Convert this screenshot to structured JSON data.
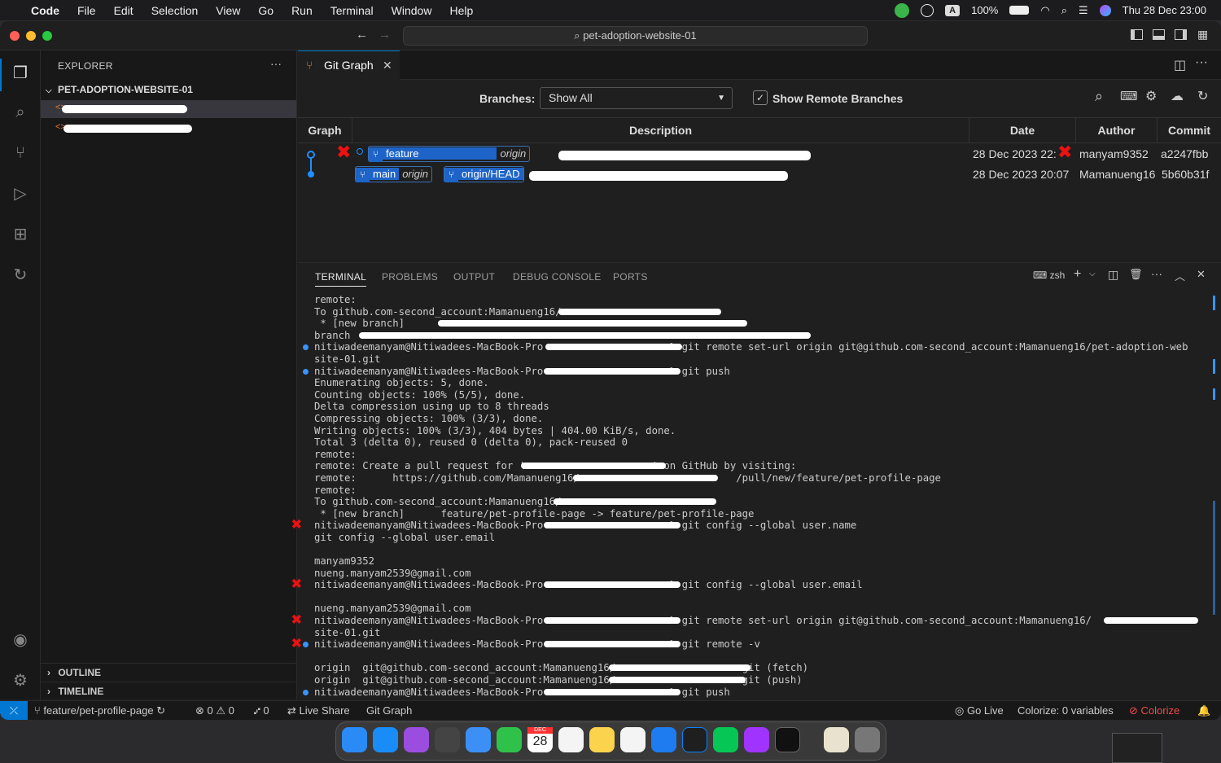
{
  "menubar": {
    "app": "Code",
    "items": [
      "File",
      "Edit",
      "Selection",
      "View",
      "Go",
      "Run",
      "Terminal",
      "Window",
      "Help"
    ],
    "input_indicator": "A",
    "battery": "100%",
    "datetime": "Thu 28 Dec  23:00"
  },
  "titlebar": {
    "search": "pet-adoption-website-01"
  },
  "sidebar": {
    "title": "EXPLORER",
    "more": "···",
    "folder": "PET-ADOPTION-WEBSITE-01",
    "outline": "OUTLINE",
    "timeline": "TIMELINE"
  },
  "editor": {
    "tab_label": "Git Graph",
    "branches_label": "Branches:",
    "branches_value": "Show All",
    "remote_toggle": "Show Remote Branches",
    "columns": {
      "graph": "Graph",
      "description": "Description",
      "date": "Date",
      "author": "Author",
      "commit": "Commit"
    },
    "commits": [
      {
        "refs": [
          {
            "name": "feature",
            "remote": "origin"
          }
        ],
        "date": "28 Dec 2023 22:",
        "author": "manyam9352",
        "hash": "a2247fbb"
      },
      {
        "refs": [
          {
            "name": "main",
            "remote": "origin"
          },
          {
            "name": "origin/HEAD",
            "remote": ""
          }
        ],
        "date": "28 Dec 2023 20:07",
        "author": "Mamanueng16",
        "hash": "5b60b31f"
      }
    ]
  },
  "panel": {
    "tabs": [
      "TERMINAL",
      "PROBLEMS",
      "OUTPUT",
      "DEBUG CONSOLE",
      "PORTS"
    ],
    "shell": "zsh",
    "lines": [
      "remote:",
      "To github.com-second_account:Mamanueng16/",
      " * [new branch]      ",
      "branch ",
      "nitiwadeemanyam@Nitiwadees-MacBook-Pro                     % git remote set-url origin git@github.com-second_account:Mamanueng16/pet-adoption-web",
      "site-01.git",
      "nitiwadeemanyam@Nitiwadees-MacBook-Pro                     % git push",
      "Enumerating objects: 5, done.",
      "Counting objects: 100% (5/5), done.",
      "Delta compression using up to 8 threads",
      "Compressing objects: 100% (3/3), done.",
      "Writing objects: 100% (3/3), 404 bytes | 404.00 KiB/s, done.",
      "Total 3 (delta 0), reused 0 (delta 0), pack-reused 0",
      "remote:",
      "remote: Create a pull request for '                     ' on GitHub by visiting:",
      "remote:      https://github.com/Mamanueng16/                          /pull/new/feature/pet-profile-page",
      "remote:",
      "To github.com-second_account:Mamanueng16/",
      " * [new branch]      feature/pet-profile-page -> feature/pet-profile-page",
      "nitiwadeemanyam@Nitiwadees-MacBook-Pro                     % git config --global user.name",
      "git config --global user.email",
      "",
      "manyam9352",
      "nueng.manyam2539@gmail.com",
      "nitiwadeemanyam@Nitiwadees-MacBook-Pro                     % git config --global user.email",
      "",
      "nueng.manyam2539@gmail.com",
      "nitiwadeemanyam@Nitiwadees-MacBook-Pro                     % git remote set-url origin git@github.com-second_account:Mamanueng16/",
      "site-01.git",
      "nitiwadeemanyam@Nitiwadees-MacBook-Pro                     % git remote -v",
      "",
      "origin  git@github.com-second_account:Mamanueng16/                    .git (fetch)",
      "origin  git@github.com-second_account:Mamanueng16/                    .git (push)",
      "nitiwadeemanyam@Nitiwadees-MacBook-Pro                     % git push"
    ]
  },
  "statusbar": {
    "branch": "feature/pet-profile-page",
    "errors": "0",
    "warnings": "0",
    "ports": "0",
    "live_share": "Live Share",
    "git_graph": "Git Graph",
    "go_live": "Go Live",
    "colorize_vars": "Colorize: 0 variables",
    "colorize": "Colorize"
  },
  "dock": {
    "calendar_month": "DEC",
    "calendar_day": "28"
  }
}
